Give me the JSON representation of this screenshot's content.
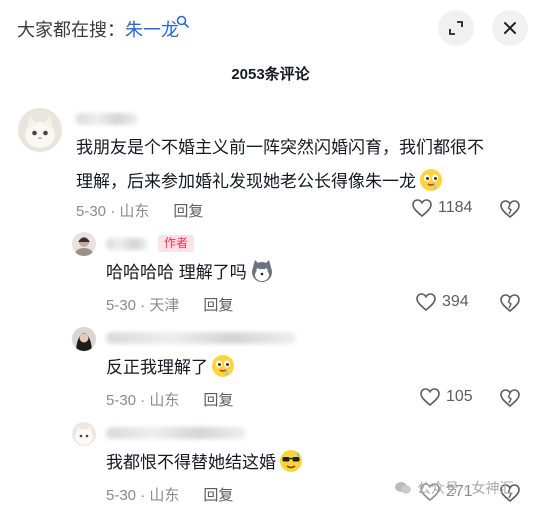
{
  "header": {
    "search_prefix": "大家都在搜：",
    "search_term": "朱一龙",
    "expand_icon": "expand-icon",
    "close_icon": "close-icon"
  },
  "comment_count": "2053条评论",
  "comments": [
    {
      "text_line1": "我朋友是个不婚主义前一阵突然闪婚闪育，我们都很不",
      "text_line2": "理解，后来参加婚礼发现她老公长得像朱一龙",
      "emoji": "drooling-face-icon",
      "date": "5-30",
      "location": "山东",
      "reply_label": "回复",
      "likes": "1184"
    }
  ],
  "replies": [
    {
      "badge": "作者",
      "text": "哈哈哈哈 理解了吗",
      "emoji": "husky-face-icon",
      "date": "5-30",
      "location": "天津",
      "reply_label": "回复",
      "likes": "394"
    },
    {
      "text": "反正我理解了",
      "emoji": "drooling-face-icon",
      "date": "5-30",
      "location": "山东",
      "reply_label": "回复",
      "likes": "105"
    },
    {
      "text": "我都恨不得替她结这婚",
      "emoji": "cool-sweat-face-icon",
      "date": "5-30",
      "location": "山东",
      "reply_label": "回复",
      "likes": "271"
    }
  ],
  "watermark": "公众号 · 女神汇"
}
